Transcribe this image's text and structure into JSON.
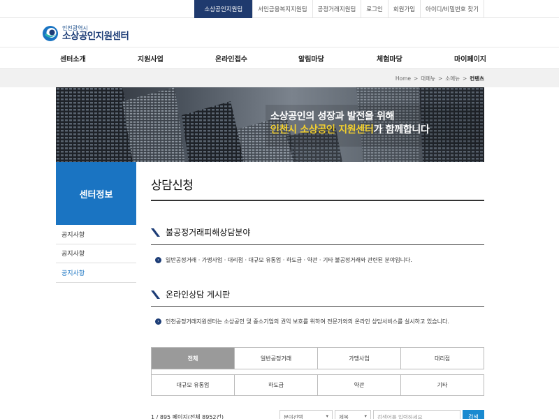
{
  "util_links": [
    "소상공인지원팀",
    "서민금융복지지원팀",
    "공정거래지원팀",
    "로그인",
    "회원가입",
    "아이디/비밀번호 찾기"
  ],
  "logo": {
    "sub": "인천광역시",
    "main": "소상공인지원센터"
  },
  "nav": [
    "센터소개",
    "지원사업",
    "온라인접수",
    "알림마당",
    "체험마당",
    "마이페이지"
  ],
  "breadcrumb": {
    "home": "Home",
    "sep": ">",
    "depth1": "대메뉴",
    "depth2": "소메뉴",
    "current": "컨텐츠"
  },
  "banner": {
    "line1": "소상공인의 성장과 발전을 위해",
    "line2_highlight": "인천시 소상공인 지원센터",
    "line2_rest": "가 함께합니다"
  },
  "sidebar": {
    "title": "센터정보",
    "items": [
      "공지사항",
      "공지사항",
      "공지사항"
    ]
  },
  "content": {
    "page_title": "상담신청",
    "section1": {
      "title": "불공정거래피해상담분야",
      "desc": "일반공정거래 · 가맹사업 · 대리점 · 대규모 유통업 · 하도급 · 약관 · 기타 불공정거래와 관련된 분야입니다."
    },
    "section2": {
      "title": "온라인상담 게시판",
      "desc": "인천공정거래지원센터는 소상공인 및 중소기업의 권익 보호를 위하여 전문가와의 온라인 상담서비스를 실시하고 있습니다."
    }
  },
  "categories": [
    "전체",
    "일반공정거래",
    "가맹사업",
    "대리점",
    "대규모 유통업",
    "하도급",
    "약관",
    "기타"
  ],
  "search": {
    "page_info": "1 / 895 페이지(전체 8952건)",
    "select1": "분야선택",
    "select2": "제목",
    "placeholder": "검색어를 입력하세요",
    "button": "검색"
  },
  "colors": {
    "navy": "#1f3a6e",
    "blue": "#1a74c2",
    "accent_yellow": "#f3d02e",
    "search_btn": "#1a8ad0"
  }
}
